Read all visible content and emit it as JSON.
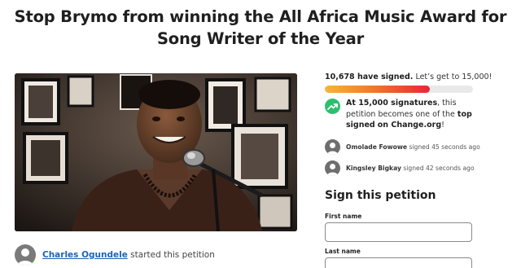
{
  "petition": {
    "title": "Stop Brymo from winning the All Africa Music Award for Song Writer of the Year",
    "starter_name": "Charles Ogundele",
    "starter_suffix": " started this petition"
  },
  "signatures": {
    "count_text": "10,678 have signed.",
    "goal_text": " Let’s get to 15,000!",
    "signed": 10678,
    "goal": 15000,
    "progress_fraction": 0.71
  },
  "milestone": {
    "bold_1": "At 15,000 signatures",
    "text_1": ", this petition becomes one of the ",
    "bold_2": "top signed",
    "text_2": " ",
    "bold_3": "on Change.org",
    "text_3": "!"
  },
  "recent_signers": [
    {
      "name": "Omolade Fowowe",
      "time": " signed 45 seconds ago"
    },
    {
      "name": "Kingsley Bigkay",
      "time": " signed 42 seconds ago"
    }
  ],
  "form": {
    "heading": "Sign this petition",
    "first_name_label": "First name",
    "first_name_value": "",
    "last_name_label": "Last name",
    "last_name_value": ""
  },
  "colors": {
    "link": "#1f63b4",
    "milestone_icon": "#2dbf6d",
    "progress_start": "#f7b538",
    "progress_end": "#e8253a"
  },
  "icons": {
    "photo": "petition-photo",
    "milestone": "trending-up-icon",
    "avatar": "person-icon"
  }
}
